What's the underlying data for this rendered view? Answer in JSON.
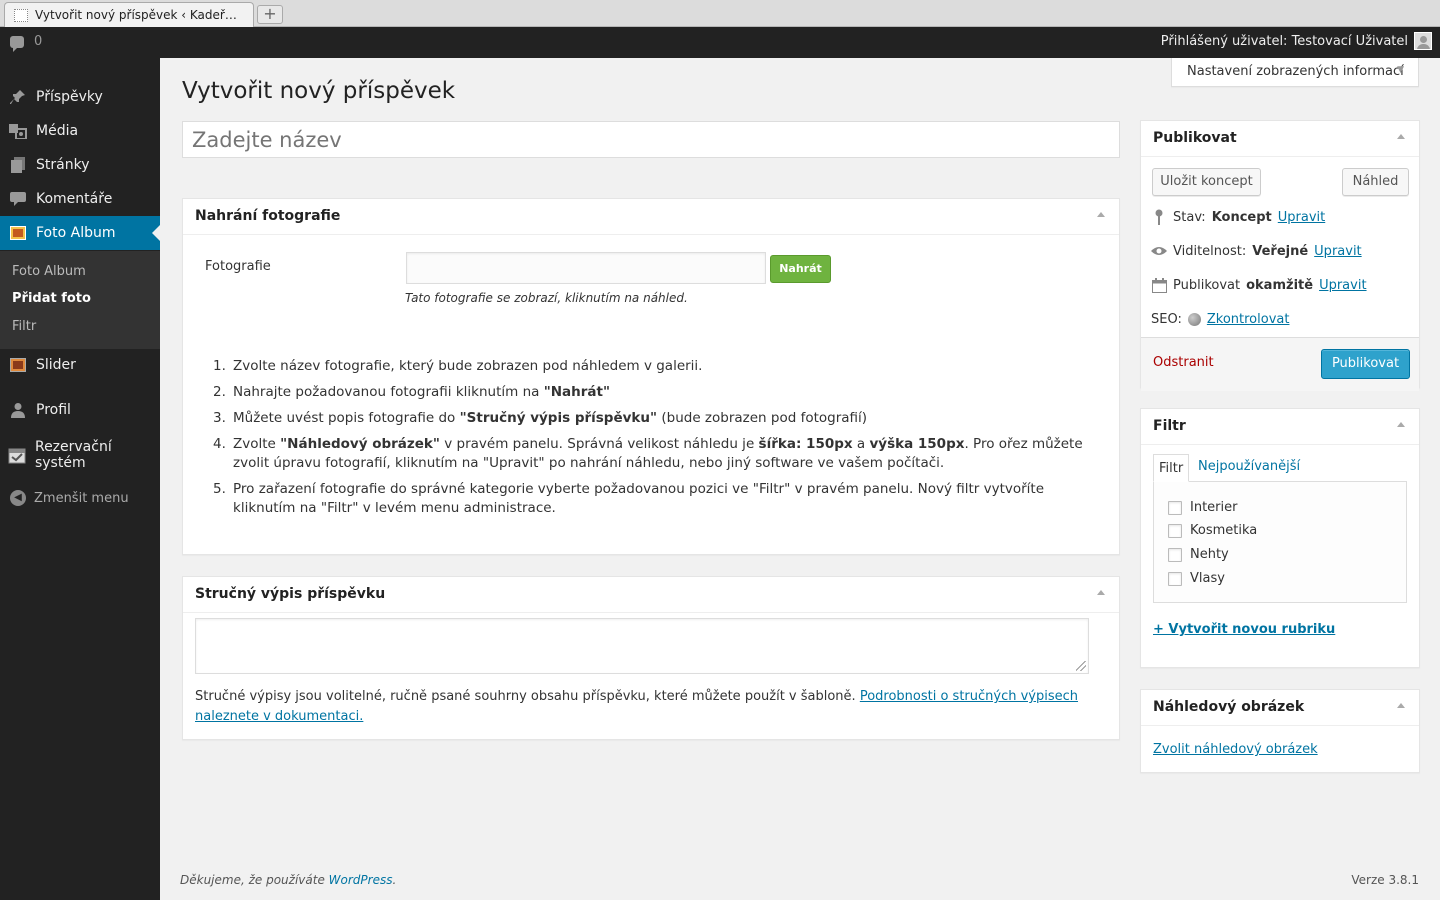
{
  "browser": {
    "tab_title": "Vytvořit nový příspěvek ‹ Kadeř…",
    "new_tab": "+"
  },
  "adminbar": {
    "comments_count": "0",
    "user_greeting": "Přihlášený uživatel: Testovací Uživatel"
  },
  "sidebar": {
    "items": [
      {
        "label": "Příspěvky",
        "icon": "pin-icon"
      },
      {
        "label": "Média",
        "icon": "media-icon"
      },
      {
        "label": "Stránky",
        "icon": "pages-icon"
      },
      {
        "label": "Komentáře",
        "icon": "comments-icon"
      },
      {
        "label": "Foto Album",
        "icon": "photo-album-icon"
      },
      {
        "label": "Slider",
        "icon": "slider-icon"
      },
      {
        "label": "Profil",
        "icon": "profile-icon"
      },
      {
        "label": "Rezervační systém",
        "icon": "reservation-icon"
      }
    ],
    "submenu": [
      "Foto Album",
      "Přidat foto",
      "Filtr"
    ],
    "collapse_label": "Zmenšit menu"
  },
  "screen_options": "Nastavení zobrazených informací",
  "page_title": "Vytvořit nový příspěvek",
  "title_placeholder": "Zadejte název",
  "upload_box": {
    "heading": "Nahrání fotografie",
    "field_label": "Fotografie",
    "button": "Nahrát",
    "hint": "Tato fotografie se zobrazí, kliknutím na náhled.",
    "instructions": [
      {
        "num": "1.",
        "html": "Zvolte název fotografie, který bude zobrazen pod náhledem v galerii."
      },
      {
        "num": "2.",
        "html": "Nahrajte požadovanou fotografii kliknutím na <b>\"Nahrát\"</b>"
      },
      {
        "num": "3.",
        "html": "Můžete uvést popis fotografie do <b>\"Stručný výpis příspěvku\"</b> (bude zobrazen pod fotografií)"
      },
      {
        "num": "4.",
        "html": "Zvolte <b>\"Náhledový obrázek\"</b> v pravém panelu. Správná velikost náhledu je <b>šířka: 150px</b> a <b>výška 150px</b>. Pro ořez můžete zvolit úpravu fotografií, kliknutím na \"Upravit\" po nahrání náhledu, nebo jiný software ve vašem počítači."
      },
      {
        "num": "5.",
        "html": "Pro zařazení fotografie do správné kategorie vyberte požadovanou pozici ve \"Filtr\" v pravém panelu. Nový filtr vytvoříte kliknutím na \"Filtr\" v levém menu administrace."
      }
    ]
  },
  "excerpt_box": {
    "heading": "Stručný výpis příspěvku",
    "help_text": "Stručné výpisy jsou volitelné, ručně psané souhrny obsahu příspěvku, které můžete použít v šabloně. ",
    "help_link": "Podrobnosti o stručných výpisech naleznete v dokumentaci."
  },
  "publish_box": {
    "heading": "Publikovat",
    "save_draft": "Uložit koncept",
    "preview": "Náhled",
    "status_label": "Stav:",
    "status_value": "Koncept",
    "visibility_label": "Viditelnost:",
    "visibility_value": "Veřejné",
    "publish_label": "Publikovat",
    "publish_value": "okamžitě",
    "edit": "Upravit",
    "seo_label": "SEO:",
    "seo_link": "Zkontrolovat",
    "delete": "Odstranit",
    "publish_button": "Publikovat"
  },
  "filter_box": {
    "heading": "Filtr",
    "tab_all": "Filtr",
    "tab_popular": "Nejpoužívanější",
    "categories": [
      "Interier",
      "Kosmetika",
      "Nehty",
      "Vlasy"
    ],
    "add_new": "+ Vytvořit novou rubriku"
  },
  "thumbnail_box": {
    "heading": "Náhledový obrázek",
    "link": "Zvolit náhledový obrázek"
  },
  "footer": {
    "thanks": "Děkujeme, že používáte ",
    "wp": "WordPress",
    "dot": ".",
    "version": "Verze 3.8.1"
  },
  "colors": {
    "admin_bar": "#222222",
    "active_menu": "#0074a2",
    "publish_button": "#2ea2cc",
    "upload_button": "#6fb33f",
    "delete_link": "#aa0000"
  }
}
